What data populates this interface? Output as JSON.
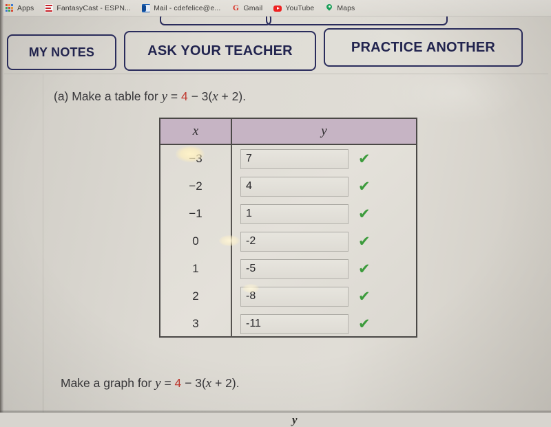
{
  "browser": {
    "bookmarks": [
      {
        "label": "Apps",
        "icon": "apps-grid-icon"
      },
      {
        "label": "FantasyCast - ESPN...",
        "icon": "espn-icon"
      },
      {
        "label": "Mail - cdefelice@e...",
        "icon": "outlook-mail-icon"
      },
      {
        "label": "Gmail",
        "icon": "gmail-icon"
      },
      {
        "label": "YouTube",
        "icon": "youtube-icon"
      },
      {
        "label": "Maps",
        "icon": "maps-pin-icon"
      }
    ]
  },
  "toolbar": {
    "my_notes": "MY NOTES",
    "ask_your_teacher": "ASK YOUR TEACHER",
    "practice_another": "PRACTICE ANOTHER",
    "border_color": "#2a2c5c"
  },
  "question": {
    "part_a": {
      "prefix": "(a) Make a table for ",
      "eq_y": "y",
      "eq_eq": " = ",
      "eq_const": "4",
      "eq_rest": " − 3(",
      "eq_x": "x",
      "eq_tail": " + 2)."
    },
    "part_b": {
      "prefix": "Make a graph for ",
      "eq_y": "y",
      "eq_eq": " = ",
      "eq_const": "4",
      "eq_rest": " − 3(",
      "eq_x": "x",
      "eq_tail": " + 2)."
    },
    "equation_highlight_color": "#c03a30"
  },
  "table": {
    "header_bg": "#c6b4c4",
    "headers": {
      "x": "x",
      "y": "y"
    },
    "rows": [
      {
        "x": "−3",
        "y": "7",
        "status": "correct",
        "check": "✔"
      },
      {
        "x": "−2",
        "y": "4",
        "status": "correct",
        "check": "✔"
      },
      {
        "x": "−1",
        "y": "1",
        "status": "correct",
        "check": "✔"
      },
      {
        "x": "0",
        "y": "-2",
        "status": "correct",
        "check": "✔"
      },
      {
        "x": "1",
        "y": "-5",
        "status": "correct",
        "check": "✔"
      },
      {
        "x": "2",
        "y": "-8",
        "status": "correct",
        "check": "✔"
      },
      {
        "x": "3",
        "y": "-11",
        "status": "correct",
        "check": "✔"
      }
    ],
    "check_color": "#3c9b3c"
  },
  "graph": {
    "y_axis_label": "y"
  }
}
